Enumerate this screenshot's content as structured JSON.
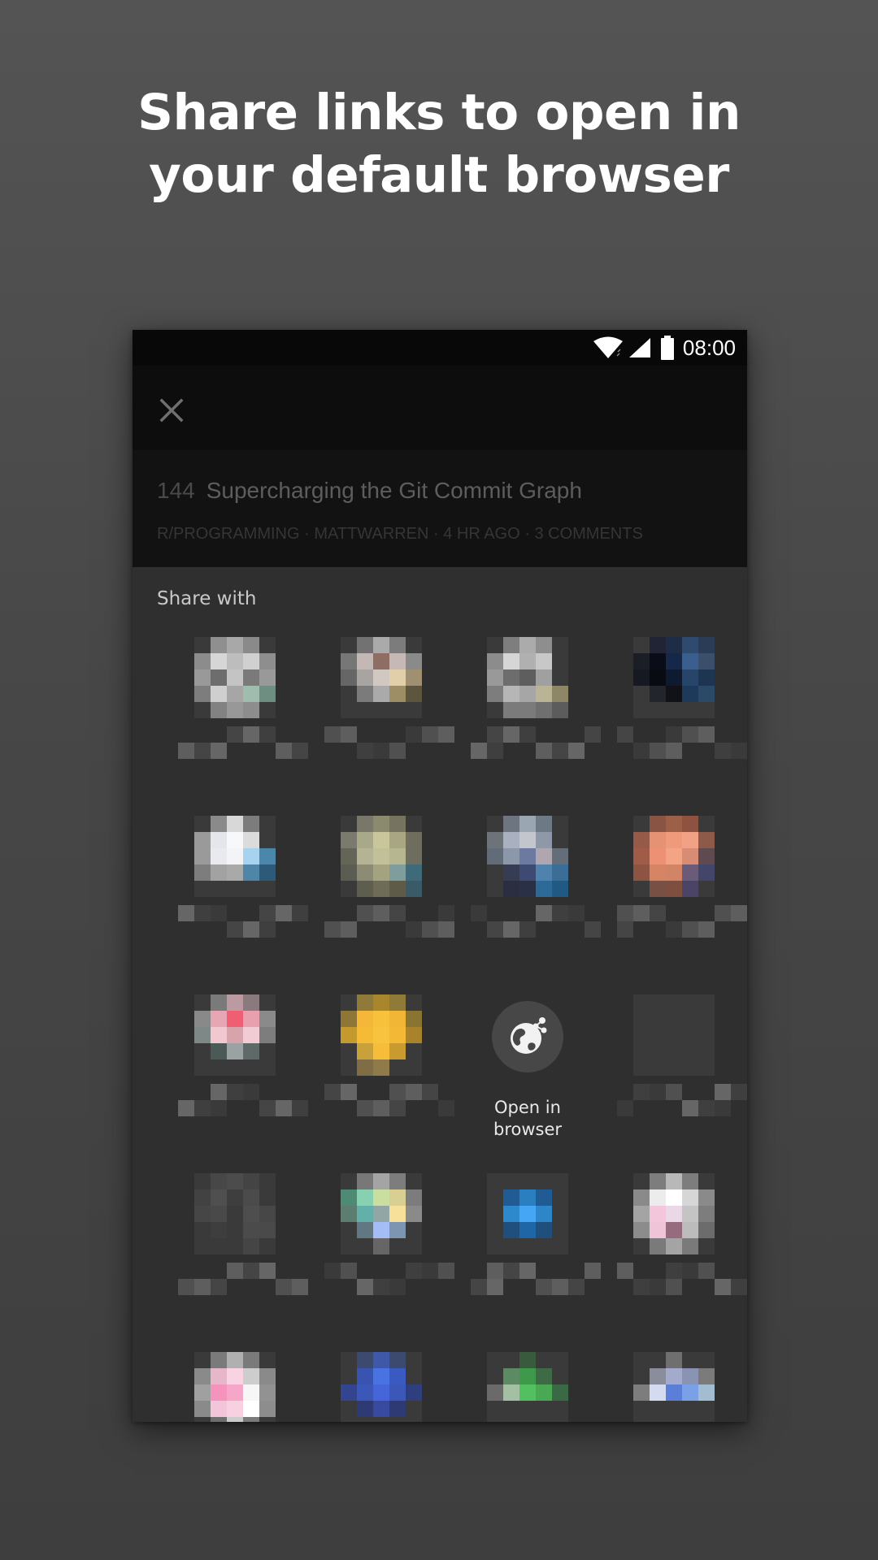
{
  "headline": {
    "line1": "Share links to open in",
    "line2": "your default browser"
  },
  "status_bar": {
    "time": "08:00",
    "icons": [
      "wifi-icon",
      "cellular-signal-icon",
      "battery-icon"
    ]
  },
  "toolbar": {
    "close_icon": "close-icon"
  },
  "post": {
    "score": "144",
    "title": "Supercharging the Git Commit Graph",
    "meta": "R/PROGRAMMING · MATTWARREN · 4 HR AGO · 3 COMMENTS"
  },
  "share_sheet": {
    "title": "Share with",
    "open_in_browser": {
      "label_line1": "Open in",
      "label_line2": "browser",
      "icon": "globe-share-icon"
    },
    "pixelated_apps": [
      {
        "icon_colors": [
          "#3a3a3a",
          "#8f8f8f",
          "#a8a8a8",
          "#8a8a8a",
          "#3a3a3a",
          "#8c8c8c",
          "#d6d6d6",
          "#bdbdbd",
          "#d0d0d0",
          "#8e8e8e",
          "#999999",
          "#6d6d6d",
          "#c4c4c4",
          "#7a7a7a",
          "#999999",
          "#7d7d7d",
          "#cfcfcf",
          "#a6a6a6",
          "#9fbcae",
          "#6e8e82",
          "#3a3a3a",
          "#828282",
          "#989898",
          "#8d8d8d",
          "#3a3a3a"
        ]
      },
      {
        "icon_colors": [
          "#3a3a3a",
          "#727272",
          "#aaaaaa",
          "#7c7c7c",
          "#3a3a3a",
          "#777777",
          "#c4b8b4",
          "#8e6e62",
          "#c6b8b4",
          "#8a8a8a",
          "#666666",
          "#a8a4a2",
          "#d2c8c2",
          "#e0cfa8",
          "#9f9072",
          "#3a3a3a",
          "#7b7b7b",
          "#aaaaaa",
          "#9e8e66",
          "#5e553e",
          "#3a3a3a",
          "#3a3a3a",
          "#3a3a3a",
          "#3a3a3a",
          "#3a3a3a"
        ]
      },
      {
        "icon_colors": [
          "#3a3a3a",
          "#7e7e7e",
          "#ababab",
          "#8e8e8e",
          "#3a3a3a",
          "#8c8c8c",
          "#d6d6d6",
          "#b0b0b0",
          "#c8c8c8",
          "#3a3a3a",
          "#999999",
          "#6d6d6d",
          "#5e5e5e",
          "#a0a0a0",
          "#3a3a3a",
          "#7d7d7d",
          "#b6b6b6",
          "#a6a6a6",
          "#b9b496",
          "#8d8667",
          "#3a3a3a",
          "#7b7b7b",
          "#7b7b7b",
          "#6f6f6f",
          "#5c5c5c"
        ]
      },
      {
        "icon_colors": [
          "#3a3a3a",
          "#202434",
          "#1f2c45",
          "#2f4a6c",
          "#2b3d56",
          "#1c1e26",
          "#0a0c18",
          "#16284a",
          "#3a5f8e",
          "#3b4e6a",
          "#161922",
          "#090b12",
          "#0e1a30",
          "#274569",
          "#1e3552",
          "#3a3a3a",
          "#23252c",
          "#111218",
          "#1d3a5a",
          "#2a4a68",
          "#3a3a3a",
          "#3a3a3a",
          "#3a3a3a",
          "#3a3a3a",
          "#3a3a3a"
        ]
      },
      {
        "icon_colors": [
          "#3a3a3a",
          "#8a8a8a",
          "#d8d8d8",
          "#7c7c7c",
          "#3a3a3a",
          "#9a9a9a",
          "#e4e6ea",
          "#f8f8fa",
          "#dbdbdb",
          "#3a3a3a",
          "#9a9a9a",
          "#e8eaee",
          "#f4f4f6",
          "#a8d3ef",
          "#4b87ab",
          "#7d7d7d",
          "#a2a2a2",
          "#a9a9a9",
          "#4f86a8",
          "#2c5a78",
          "#3a3a3a",
          "#3a3a3a",
          "#3a3a3a",
          "#3a3a3a",
          "#3a3a3a"
        ]
      },
      {
        "icon_colors": [
          "#3a3a3a",
          "#79776a",
          "#8b896e",
          "#767360",
          "#3a3a3a",
          "#7b7a6e",
          "#a8a98a",
          "#c8c69a",
          "#a9a783",
          "#6f6d5e",
          "#646457",
          "#b4b393",
          "#c2c098",
          "#b6b690",
          "#6e6e60",
          "#5b5c52",
          "#8c8b74",
          "#a3a37f",
          "#7f9d9c",
          "#3e6a7a",
          "#3a3a3a",
          "#5e5e4e",
          "#6e6c56",
          "#5e5c49",
          "#3b5a68"
        ]
      },
      {
        "icon_colors": [
          "#3a3a3a",
          "#6d7580",
          "#9aa6b1",
          "#6d7a86",
          "#3a3a3a",
          "#6e737a",
          "#a9b1c0",
          "#c3c6cc",
          "#8e98a6",
          "#3a3a3a",
          "#626c78",
          "#8c98aa",
          "#6c7aa0",
          "#b0a6b0",
          "#636e79",
          "#3a3a3a",
          "#353c54",
          "#3e4a72",
          "#4f82ad",
          "#3a6e96",
          "#3a3a3a",
          "#2a2e40",
          "#2a3046",
          "#2d6a98",
          "#205a84"
        ]
      },
      {
        "icon_colors": [
          "#3a3a3a",
          "#8a5445",
          "#9c6048",
          "#8d5240",
          "#3a3a3a",
          "#955a48",
          "#e59274",
          "#ee9a7b",
          "#f1a286",
          "#8d5a4a",
          "#a05c48",
          "#ec9174",
          "#f3a484",
          "#d98c74",
          "#5f4a50",
          "#8d5444",
          "#d58564",
          "#d18466",
          "#6a5c78",
          "#44456a",
          "#3a3a3a",
          "#785044",
          "#7e4e3e",
          "#4c4466",
          "#3a3a3a"
        ]
      },
      {
        "icon_colors": [
          "#3a3a3a",
          "#7a7a7a",
          "#bb9aa2",
          "#8a7a7e",
          "#3a3a3a",
          "#898989",
          "#e6a6b4",
          "#f05e74",
          "#e8a0ae",
          "#8a8a8a",
          "#7d8887",
          "#f2c8d0",
          "#d8a4ac",
          "#f2ccd4",
          "#7d7d7d",
          "#3a3a3a",
          "#4c5a57",
          "#9aa3a2",
          "#5e6968",
          "#3a3a3a",
          "#3a3a3a",
          "#3a3a3a",
          "#3a3a3a",
          "#3a3a3a",
          "#3a3a3a"
        ]
      },
      {
        "icon_colors": [
          "#3a3a3a",
          "#8f7a3a",
          "#a8862e",
          "#8f7a3a",
          "#3a3a3a",
          "#8d7636",
          "#f4b73a",
          "#f7c13c",
          "#f1b635",
          "#8a7433",
          "#c49a2e",
          "#f5bb36",
          "#f8c33e",
          "#f3b836",
          "#a8832b",
          "#3a3a3a",
          "#c9a13a",
          "#f6bd3a",
          "#c89a2f",
          "#3a3a3a",
          "#3a3a3a",
          "#7f6e45",
          "#8f7a4a",
          "#3a3a3a",
          "#3a3a3a"
        ]
      },
      {
        "icon_colors": [
          "#3a3a3a",
          "#3a3a3a",
          "#3a3a3a",
          "#3a3a3a",
          "#3a3a3a",
          "#3a3a3a",
          "#3a3a3a",
          "#3a3a3a",
          "#3a3a3a",
          "#3a3a3a",
          "#3a3a3a",
          "#3a3a3a",
          "#3a3a3a",
          "#3a3a3a",
          "#3a3a3a",
          "#3a3a3a",
          "#3a3a3a",
          "#3a3a3a",
          "#3a3a3a",
          "#3a3a3a",
          "#3a3a3a",
          "#3a3a3a",
          "#3a3a3a",
          "#3a3a3a",
          "#3a3a3a"
        ]
      },
      {
        "icon_colors": [
          "#3a3a3a",
          "#474747",
          "#4c4c4c",
          "#444444",
          "#3a3a3a",
          "#424242",
          "#4f4f4f",
          "#3e3e3e",
          "#4b4b4b",
          "#3a3a3a",
          "#464646",
          "#494949",
          "#3a3a3a",
          "#4e4e4e",
          "#474747",
          "#3a3a3a",
          "#3e3e3e",
          "#3a3a3a",
          "#4b4b4b",
          "#4a4a4a",
          "#3a3a3a",
          "#3a3a3a",
          "#3a3a3a",
          "#454545",
          "#3a3a3a"
        ]
      },
      {
        "icon_colors": [
          "#3a3a3a",
          "#787878",
          "#a4a4a4",
          "#7d7d7d",
          "#3a3a3a",
          "#4e8b74",
          "#88d0b2",
          "#c9dea0",
          "#d8d092",
          "#7c7c7c",
          "#5b7e70",
          "#63b0a8",
          "#93a6a6",
          "#f7e09a",
          "#8a8a8a",
          "#3a3a3a",
          "#617782",
          "#a4bdf7",
          "#7e95b1",
          "#3a3a3a",
          "#3a3a3a",
          "#3a3a3a",
          "#666666",
          "#3a3a3a",
          "#3a3a3a"
        ]
      },
      {
        "icon_colors": [
          "#3a3a3a",
          "#3a3a3a",
          "#3a3a3a",
          "#3a3a3a",
          "#3a3a3a",
          "#3a3a3a",
          "#205c93",
          "#2a7fc0",
          "#205c93",
          "#3a3a3a",
          "#3a3a3a",
          "#2e88cc",
          "#45a6f6",
          "#2d86c8",
          "#3a3a3a",
          "#3a3a3a",
          "#204f7e",
          "#1f66a6",
          "#204f7e",
          "#3a3a3a",
          "#3a3a3a",
          "#3a3a3a",
          "#3a3a3a",
          "#3a3a3a",
          "#3a3a3a"
        ]
      },
      {
        "icon_colors": [
          "#3a3a3a",
          "#7d7d7d",
          "#b8b8b8",
          "#7d7d7d",
          "#3a3a3a",
          "#8a8a8a",
          "#ececec",
          "#ffffff",
          "#d6d6d6",
          "#8a8a8a",
          "#a4a4a4",
          "#f4c6dc",
          "#ead8e6",
          "#c4c4c4",
          "#7d7d7d",
          "#8c8c8c",
          "#f0c4d8",
          "#976b7e",
          "#bcbcbc",
          "#6c6c6c",
          "#3a3a3a",
          "#7a7a7a",
          "#a4a4a4",
          "#7a7a7a",
          "#3a3a3a"
        ]
      },
      {
        "icon_colors": [
          "#3a3a3a",
          "#7a7a7a",
          "#b0b0b0",
          "#7a7a7a",
          "#3a3a3a",
          "#8a8a8a",
          "#e6b7c8",
          "#f8d4e2",
          "#cdcdcd",
          "#8a8a8a",
          "#a0a0a0",
          "#f494bc",
          "#f6a6c8",
          "#f6f6f6",
          "#929292",
          "#8a8a8a",
          "#f3c5d8",
          "#f7d1e0",
          "#ffffff",
          "#8d8d8d",
          "#3a3a3a",
          "#6e6e6e",
          "#cccccc",
          "#7b7b7b",
          "#3a3a3a"
        ]
      },
      {
        "icon_colors": [
          "#3a3a3a",
          "#3c4a70",
          "#3f58a8",
          "#3c4a70",
          "#3a3a3a",
          "#3a3a3a",
          "#3853b0",
          "#4a73e2",
          "#3a5ac2",
          "#3a3a3a",
          "#334490",
          "#3b58b8",
          "#4565d8",
          "#3b58b8",
          "#2f3f7e",
          "#3a3a3a",
          "#2e3a74",
          "#384aa0",
          "#2e3a74",
          "#3a3a3a",
          "#3a3a3a",
          "#3a3a3a",
          "#3a3a3a",
          "#3a3a3a",
          "#3a3a3a"
        ]
      },
      {
        "icon_colors": [
          "#3a3a3a",
          "#3a3a3a",
          "#3a5a3e",
          "#3a3a3a",
          "#3a3a3a",
          "#3a3a3a",
          "#5c8a62",
          "#3e9a4a",
          "#3e6a45",
          "#3a3a3a",
          "#6a6a6a",
          "#a4c0a4",
          "#52c060",
          "#48a854",
          "#3a6a45",
          "#3a3a3a",
          "#3a3a3a",
          "#3a3a3a",
          "#3a3a3a",
          "#3a3a3a",
          "#3a3a3a",
          "#3a3a3a",
          "#3a3a3a",
          "#3a3a3a",
          "#3a3a3a"
        ]
      },
      {
        "icon_colors": [
          "#3a3a3a",
          "#3a3a3a",
          "#6f6f6f",
          "#3a3a3a",
          "#3a3a3a",
          "#3a3a3a",
          "#8a8e9c",
          "#a4aacb",
          "#8a93b2",
          "#7b7b7b",
          "#7d7d7d",
          "#d4daf0",
          "#5b7fd8",
          "#7aa0e6",
          "#a4bcd0",
          "#3a3a3a",
          "#3a3a3a",
          "#3a3a3a",
          "#3a3a3a",
          "#3a3a3a",
          "#3a3a3a",
          "#3a3a3a",
          "#3a3a3a",
          "#3a3a3a",
          "#3a3a3a"
        ]
      },
      {
        "icon_colors": [
          "#3a3a3a",
          "#3a3a3a",
          "#3a3a3a",
          "#3a3a3a",
          "#3a3a3a",
          "#3a3a3a",
          "#2a5a78",
          "#3b86ac",
          "#2f7ba6",
          "#254f6c",
          "#2a5a78",
          "#8ed6f6",
          "#9ce0f6",
          "#30a6e6",
          "#2a6a96",
          "#3a3a3a",
          "#3a3a3a",
          "#3a3a3a",
          "#3a3a3a",
          "#3a3a3a",
          "#3a3a3a",
          "#3a3a3a",
          "#3a3a3a",
          "#3a3a3a",
          "#3a3a3a"
        ]
      }
    ]
  },
  "colors": {
    "background": "#4a4a4a",
    "phone_sheet": "#2f2f2f",
    "status_bar": "#080808",
    "headline_text": "#ffffff"
  }
}
